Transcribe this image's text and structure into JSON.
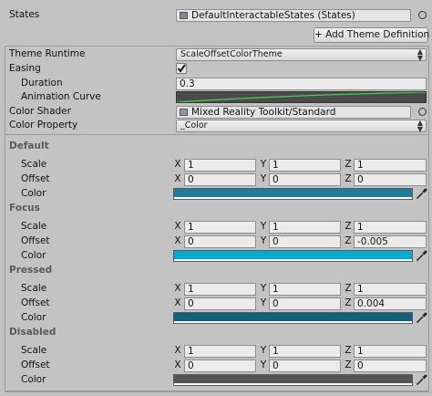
{
  "top": {
    "states_label": "States",
    "states_value": "DefaultInteractableStates (States)",
    "add_theme_label": "+ Add Theme Definition"
  },
  "theme": {
    "runtime_label": "Theme Runtime",
    "runtime_value": "ScaleOffsetColorTheme",
    "easing_label": "Easing",
    "easing_checked": true,
    "duration_label": "Duration",
    "duration_value": "0.3",
    "curve_label": "Animation Curve",
    "curve_color": "#3ed14a",
    "shader_label": "Color Shader",
    "shader_value": "Mixed Reality Toolkit/Standard",
    "color_property_label": "Color Property",
    "color_property_value": "_Color"
  },
  "state_labels": {
    "scale": "Scale",
    "offset": "Offset",
    "color": "Color",
    "x": "X",
    "y": "Y",
    "z": "Z"
  },
  "states": [
    {
      "name": "Default",
      "scale": [
        "1",
        "1",
        "1"
      ],
      "offset": [
        "0",
        "0",
        "0"
      ],
      "color": "#1f7d9c"
    },
    {
      "name": "Focus",
      "scale": [
        "1",
        "1",
        "1"
      ],
      "offset": [
        "0",
        "0",
        "-0.005"
      ],
      "color": "#06a9d2"
    },
    {
      "name": "Pressed",
      "scale": [
        "1",
        "1",
        "1"
      ],
      "offset": [
        "0",
        "0",
        "0.004"
      ],
      "color": "#10627c"
    },
    {
      "name": "Disabled",
      "scale": [
        "1",
        "1",
        "1"
      ],
      "offset": [
        "0",
        "0",
        "0"
      ],
      "color": "#555555"
    }
  ],
  "colors": {
    "background": "#c2c2c2",
    "panel_border": "#9a9a9a",
    "section_title": "#5a5a5a"
  }
}
